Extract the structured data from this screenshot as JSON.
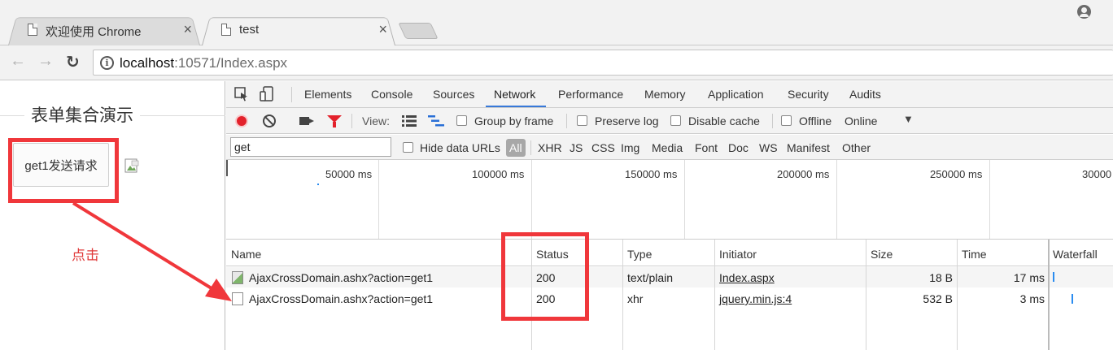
{
  "browser": {
    "tabs": [
      {
        "title": "欢迎使用 Chrome",
        "active": false
      },
      {
        "title": "test",
        "active": true
      }
    ],
    "tab_close_glyph": "×",
    "address": {
      "host": "localhost",
      "rest": ":10571/Index.aspx"
    },
    "nav": {
      "back": "←",
      "forward": "→",
      "reload": "↻"
    }
  },
  "page": {
    "legend": "表单集合演示",
    "get_button": "get1发送请求",
    "annotation_label": "点击"
  },
  "devtools": {
    "tabs": [
      "Elements",
      "Console",
      "Sources",
      "Network",
      "Performance",
      "Memory",
      "Application",
      "Security",
      "Audits"
    ],
    "selected_tab": "Network",
    "tab_accent": "#3879d9",
    "controls": {
      "view_label": "View:",
      "group_by_frame": "Group by frame",
      "preserve_log": "Preserve log",
      "disable_cache": "Disable cache",
      "offline": "Offline",
      "throttle": "Online",
      "dropdown_glyph": "▼"
    },
    "filter": {
      "value": "get",
      "hide_data_urls": "Hide data URLs",
      "types": [
        "All",
        "XHR",
        "JS",
        "CSS",
        "Img",
        "Media",
        "Font",
        "Doc",
        "WS",
        "Manifest",
        "Other"
      ],
      "selected_type": "All"
    },
    "overview_ticks": [
      "50000 ms",
      "100000 ms",
      "150000 ms",
      "200000 ms",
      "250000 ms",
      "30000"
    ],
    "columns": [
      "Name",
      "Status",
      "Type",
      "Initiator",
      "Size",
      "Time",
      "Waterfall"
    ],
    "rows": [
      {
        "name": "AjaxCrossDomain.ashx?action=get1",
        "status": "200",
        "type": "text/plain",
        "initiator": "Index.aspx",
        "size": "18 B",
        "time": "17 ms"
      },
      {
        "name": "AjaxCrossDomain.ashx?action=get1",
        "status": "200",
        "type": "xhr",
        "initiator": "jquery.min.js:4",
        "size": "532 B",
        "time": "3 ms"
      }
    ],
    "record_color": "#e3212b",
    "waterfall_color": "#2a8cf0"
  },
  "annotation": {
    "highlight_color": "#f0373b"
  }
}
